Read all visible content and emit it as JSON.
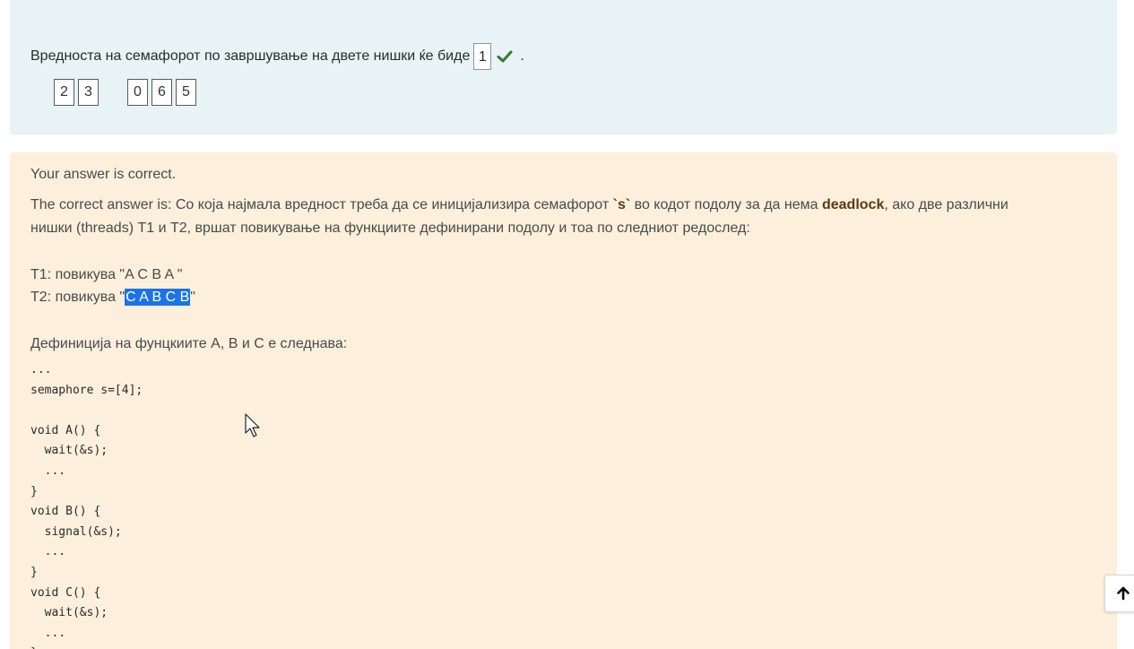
{
  "question": {
    "text": "Вредноста на семафорот по завршување на двете нишки ќе биде",
    "answer_value": "1",
    "period": ".",
    "check_icon": "check-icon",
    "choices_group1": [
      "2",
      "3"
    ],
    "choices_group2": [
      "0",
      "6",
      "5"
    ]
  },
  "feedback": {
    "correct_msg": "Your answer is correct.",
    "answer_prefix": "The correct answer is: Со која најмала вредност треба да се иницијализира семафорот ",
    "sem_name": "`s`",
    "answer_mid": " во кодот подолу за да нема ",
    "deadlock": "deadlock",
    "answer_suffix": ", ако две различни",
    "answer_line2": "нишки (threads) T1 и T2, вршат повикување на функциите дефинирани подолу и тоа по следниот редослед:",
    "t1": "T1: повикува \"A C B A \"",
    "t2_prefix": "T2: повикува \"",
    "t2_highlight": "C A B C B",
    "t2_suffix": "\"",
    "definition_line": "Дефиниција на фунцкиите A, B и C е следнава:",
    "code": "...\nsemaphore s=[4];\n\nvoid A() {\n  wait(&s);\n  ...\n}\nvoid B() {\n  signal(&s);\n  ...\n}\nvoid C() {\n  wait(&s);\n  ...\n}"
  },
  "scroll_top_icon": "arrow-up-icon",
  "colors": {
    "question_bg": "#e7f3f5",
    "feedback_bg": "#fcefdc",
    "check_green": "#357a32",
    "highlight": "#1a73e8"
  }
}
